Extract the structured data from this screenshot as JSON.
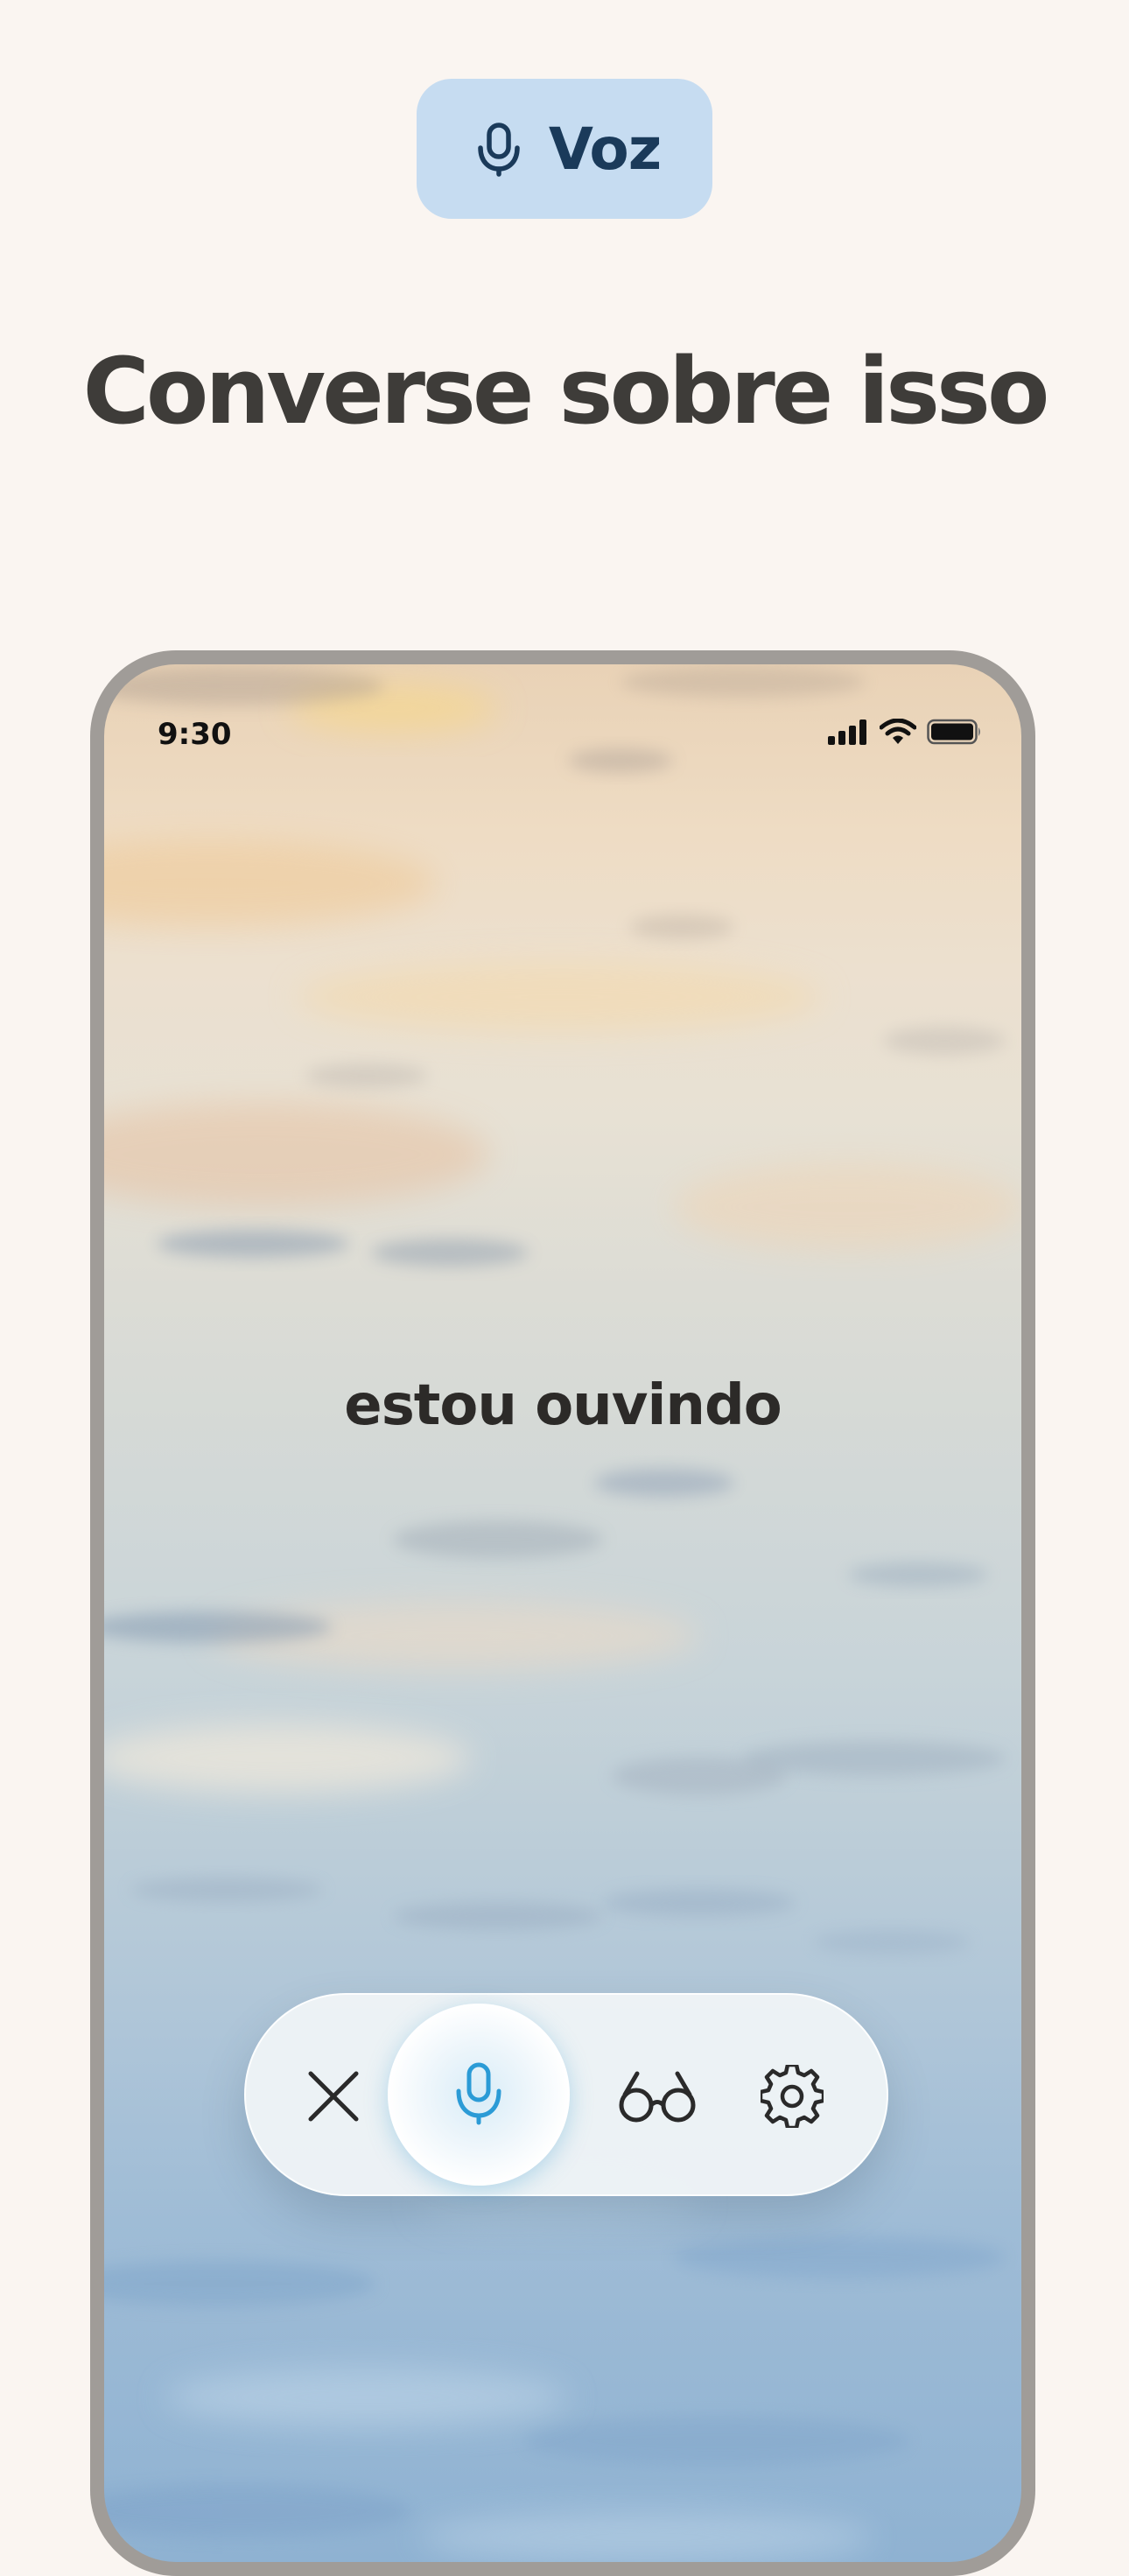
{
  "badge": {
    "label": "Voz",
    "icon": "microphone-icon",
    "background": "#c6dcf1",
    "text_color": "#1a3a5a"
  },
  "headline": "Converse sobre isso",
  "phone": {
    "status_bar": {
      "time": "9:30",
      "icons": [
        "cellular-signal-icon",
        "wifi-icon",
        "battery-icon"
      ]
    },
    "prompt": "estou ouvindo",
    "controls": [
      {
        "name": "close",
        "icon": "close-icon"
      },
      {
        "name": "microphone",
        "icon": "microphone-icon",
        "active": true,
        "accent": "#2b9bd6"
      },
      {
        "name": "glasses",
        "icon": "glasses-icon"
      },
      {
        "name": "settings",
        "icon": "gear-icon"
      }
    ]
  },
  "colors": {
    "page_background": "#faf5f1",
    "headline": "#3e3c39",
    "phone_frame": "#a09c98",
    "mic_accent": "#2b9bd6"
  }
}
